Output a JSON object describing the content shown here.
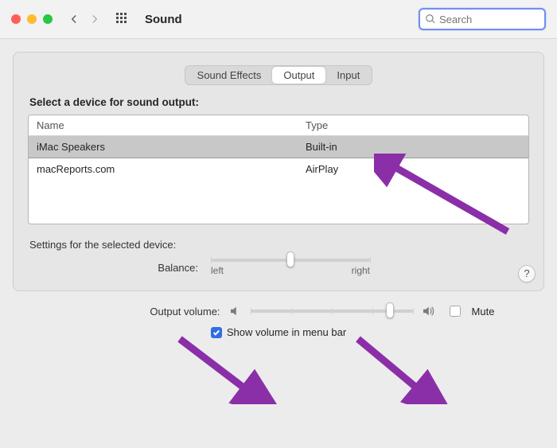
{
  "header": {
    "title": "Sound",
    "search_placeholder": "Search"
  },
  "tabs": {
    "items": [
      "Sound Effects",
      "Output",
      "Input"
    ],
    "active_index": 1
  },
  "main": {
    "select_device_heading": "Select a device for sound output:",
    "columns": {
      "name": "Name",
      "type": "Type"
    },
    "devices": [
      {
        "name": "iMac Speakers",
        "type": "Built-in",
        "selected": true
      },
      {
        "name": "macReports.com",
        "type": "AirPlay",
        "selected": false
      }
    ],
    "settings_heading": "Settings for the selected device:",
    "balance": {
      "label": "Balance:",
      "left_label": "left",
      "right_label": "right",
      "value": 0.5
    },
    "help_label": "?"
  },
  "footer": {
    "volume_label": "Output volume:",
    "volume_value": 0.86,
    "mute_label": "Mute",
    "mute_checked": false,
    "show_in_menubar_label": "Show volume in menu bar",
    "show_in_menubar_checked": true
  },
  "annotation_color": "#8a2fa8"
}
